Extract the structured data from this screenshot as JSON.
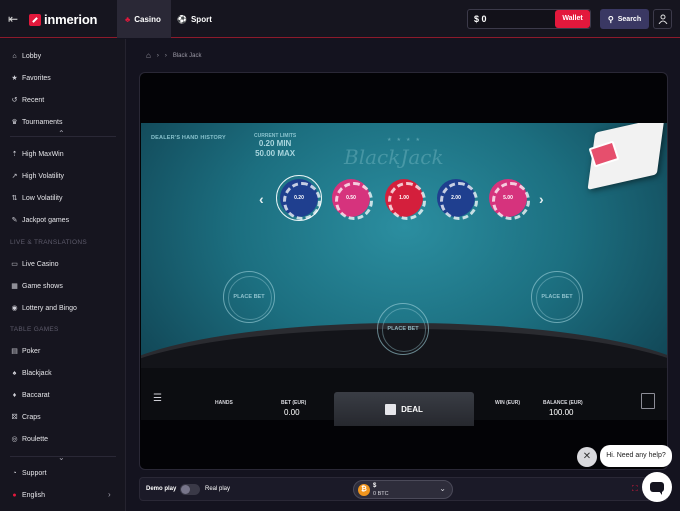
{
  "header": {
    "brand": "inmerion",
    "tabs": [
      {
        "label": "Casino",
        "icon": "casino-icon",
        "active": true
      },
      {
        "label": "Sport",
        "icon": "sport-icon",
        "active": false
      }
    ],
    "balance": "$ 0",
    "wallet_label": "Wallet",
    "search_label": "Search"
  },
  "sidebar": {
    "items_top": [
      {
        "label": "Lobby",
        "icon": "home-icon"
      },
      {
        "label": "Favorites",
        "icon": "star-icon"
      },
      {
        "label": "Recent",
        "icon": "history-icon"
      },
      {
        "label": "Tournaments",
        "icon": "trophy-icon"
      }
    ],
    "items_casino": [
      {
        "label": "High MaxWin",
        "icon": "maxwin-icon"
      },
      {
        "label": "High Volatility",
        "icon": "volatility-high-icon"
      },
      {
        "label": "Low Volatility",
        "icon": "volatility-low-icon"
      },
      {
        "label": "Jackpot games",
        "icon": "jackpot-icon"
      }
    ],
    "section_live": "LIVE & TRANSLATIONS",
    "items_live": [
      {
        "label": "Live Casino",
        "icon": "live-icon"
      },
      {
        "label": "Game shows",
        "icon": "gameshow-icon"
      },
      {
        "label": "Lottery and Bingo",
        "icon": "lottery-icon"
      }
    ],
    "section_table": "TABLE GAMES",
    "items_table": [
      {
        "label": "Poker",
        "icon": "poker-icon"
      },
      {
        "label": "Blackjack",
        "icon": "blackjack-icon"
      },
      {
        "label": "Baccarat",
        "icon": "baccarat-icon"
      },
      {
        "label": "Craps",
        "icon": "dice-icon"
      },
      {
        "label": "Roulette",
        "icon": "roulette-icon"
      }
    ],
    "support": "Support",
    "language": "English"
  },
  "breadcrumb": {
    "current": "Black Jack"
  },
  "game": {
    "hand_history": "DEALER'S HAND HISTORY",
    "limits_label": "CURRENT LIMITS",
    "limit_min": "0.20 MIN",
    "limit_max": "50.00 MAX",
    "table_title": "BlackJack",
    "chips": [
      {
        "value": "0.20",
        "color": "#1f3f8f"
      },
      {
        "value": "0.50",
        "color": "#d6337d"
      },
      {
        "value": "1.00",
        "color": "#d41f3c"
      },
      {
        "value": "2.00",
        "color": "#1f3f8f"
      },
      {
        "value": "5.00",
        "color": "#d6337d"
      }
    ],
    "place_bet": "PLACE BET",
    "hud": {
      "hands_label": "HANDS",
      "bet_label": "BET (EUR)",
      "bet_value": "0.00",
      "deal_label": "DEAL",
      "win_label": "WIN (EUR)",
      "balance_label": "BALANCE (EUR)",
      "balance_value": "100.00"
    }
  },
  "controls": {
    "demo_label": "Demo play",
    "real_label": "Real play",
    "currency_symbol": "$",
    "currency_value": "0 BTC"
  },
  "chat": {
    "greeting": "Hi. Need any help?"
  }
}
